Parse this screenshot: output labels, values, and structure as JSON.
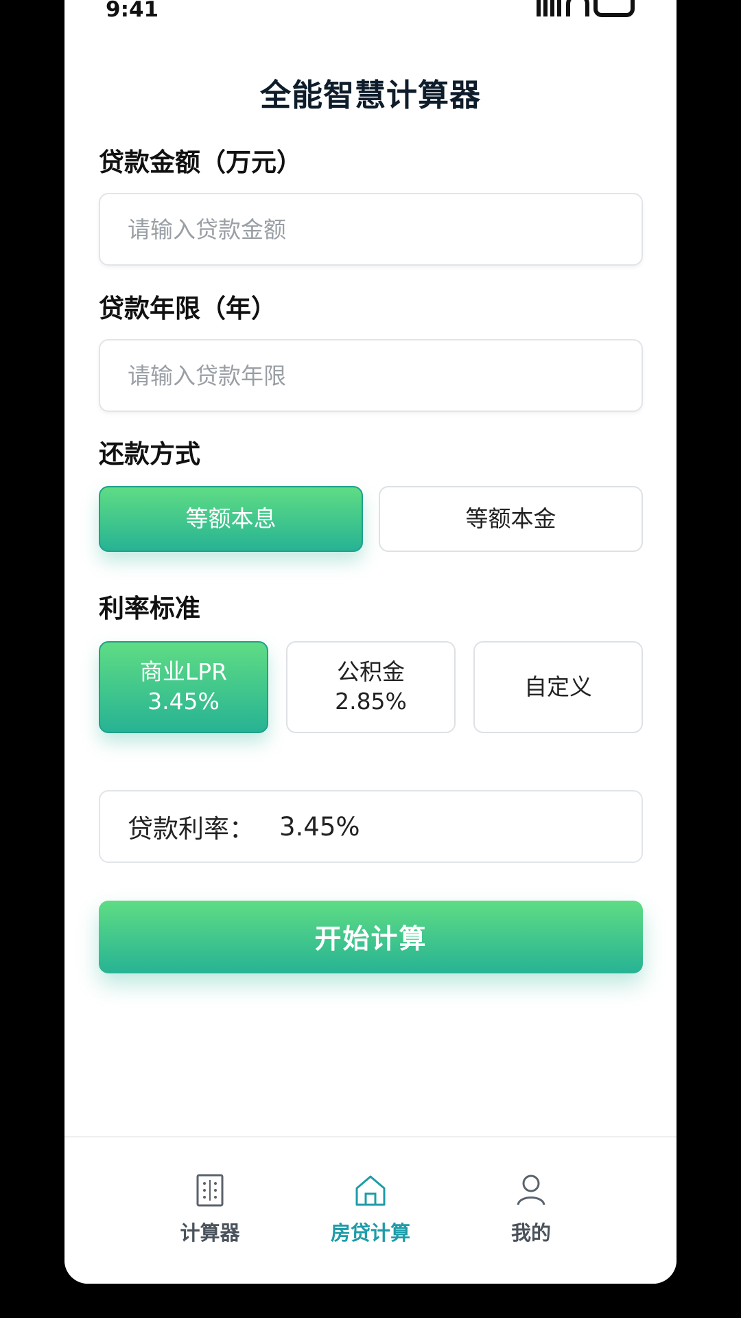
{
  "status_bar": {
    "time": "9:41"
  },
  "header": {
    "title": "全能智慧计算器"
  },
  "form": {
    "amount": {
      "label": "贷款金额（万元）",
      "placeholder": "请输入贷款金额",
      "value": ""
    },
    "years": {
      "label": "贷款年限（年）",
      "placeholder": "请输入贷款年限",
      "value": ""
    },
    "repayment": {
      "label": "还款方式",
      "options": [
        {
          "label": "等额本息",
          "selected": true
        },
        {
          "label": "等额本金",
          "selected": false
        }
      ]
    },
    "rate_standard": {
      "label": "利率标准",
      "options": [
        {
          "name": "商业LPR",
          "rate": "3.45%",
          "selected": true
        },
        {
          "name": "公积金",
          "rate": "2.85%",
          "selected": false
        },
        {
          "name": "自定义",
          "selected": false
        }
      ]
    },
    "loan_rate": {
      "label": "贷款利率：",
      "value": "3.45%"
    },
    "submit_label": "开始计算"
  },
  "tab_bar": {
    "items": [
      {
        "label": "计算器",
        "icon": "calculator-icon",
        "active": false
      },
      {
        "label": "房贷计算",
        "icon": "house-icon",
        "active": true
      },
      {
        "label": "我的",
        "icon": "user-icon",
        "active": false
      }
    ]
  },
  "colors": {
    "accent_gradient_top": "#5fdc84",
    "accent_gradient_bottom": "#27b394",
    "active_tab": "#1d9ca8"
  }
}
